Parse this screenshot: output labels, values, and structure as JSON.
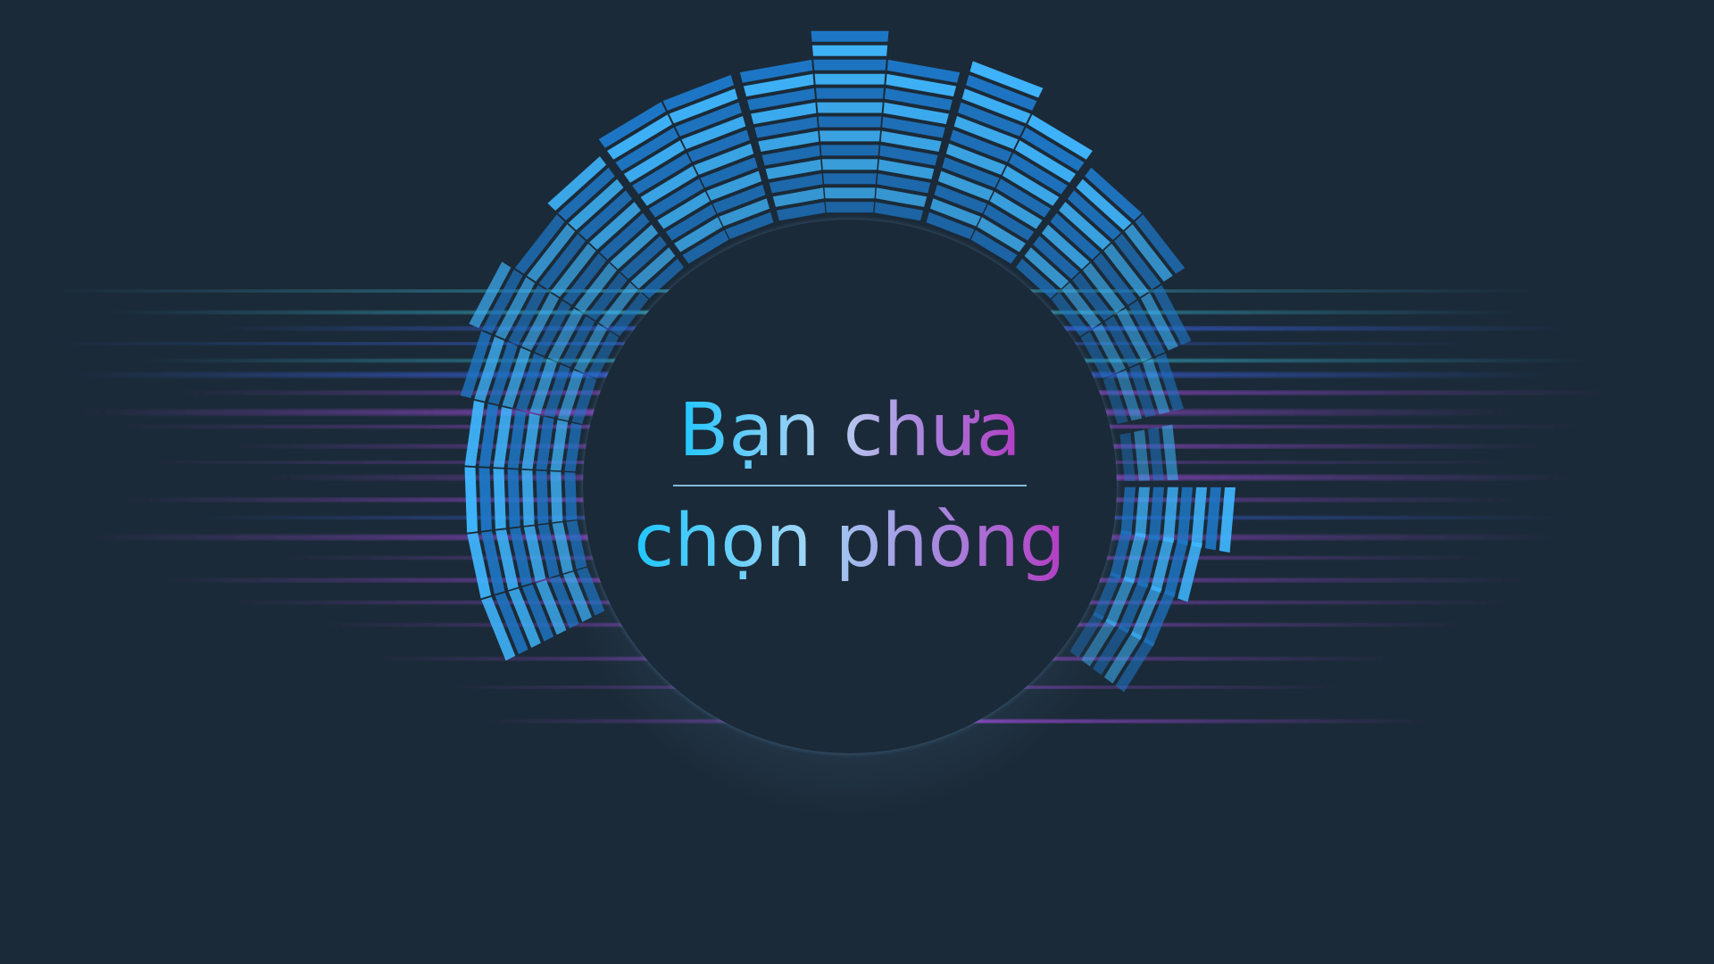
{
  "message": {
    "line1": "Bạn chưa",
    "line2": "chọn phòng"
  },
  "colors": {
    "background": "#1b2a38",
    "bar_light": "#3fb7ff",
    "bar_dark": "#1e78c8",
    "streak_cyan": "#3fd1f0",
    "streak_blue": "#3f6cff",
    "streak_purple": "#a34ce0",
    "text_gradient_start": "#1fc6ff",
    "text_gradient_end": "#b23cc2",
    "divider": "#8fc9ea"
  }
}
